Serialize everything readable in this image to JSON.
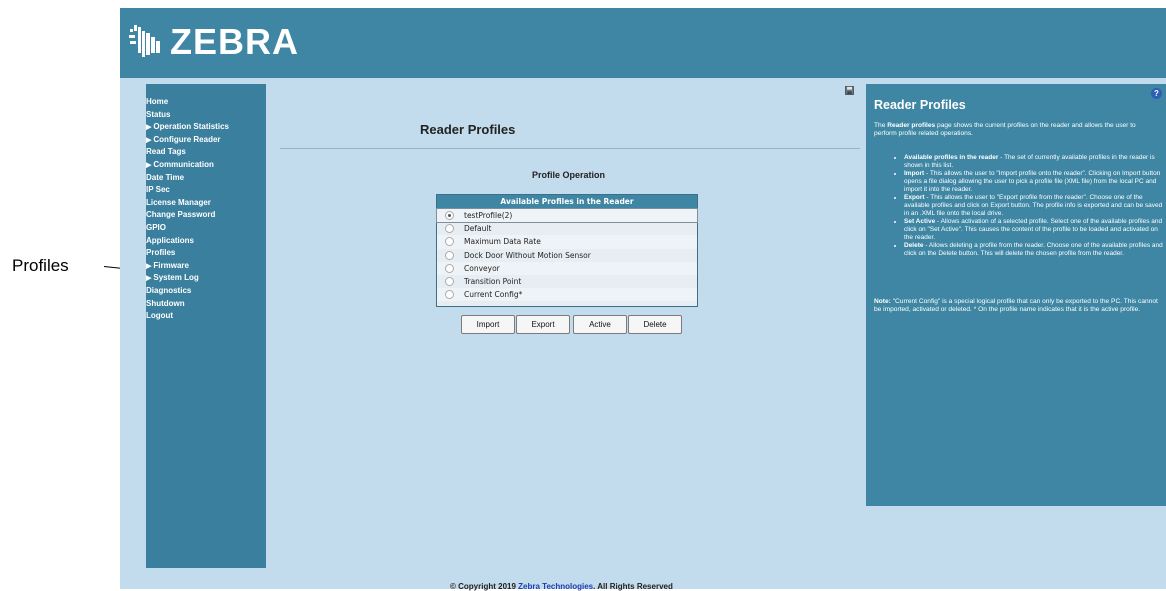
{
  "callout": {
    "label": "Profiles"
  },
  "brand": {
    "logo_text": "ZEBRA"
  },
  "sidebar": {
    "items": [
      {
        "label": "Home",
        "has_arrow": false
      },
      {
        "label": "Status",
        "has_arrow": false
      },
      {
        "label": "Operation Statistics",
        "has_arrow": true
      },
      {
        "label": "Configure Reader",
        "has_arrow": true
      },
      {
        "label": "Read Tags",
        "has_arrow": false
      },
      {
        "label": "Communication",
        "has_arrow": true
      },
      {
        "label": "Date Time",
        "has_arrow": false
      },
      {
        "label": "IP Sec",
        "has_arrow": false
      },
      {
        "label": "License Manager",
        "has_arrow": false
      },
      {
        "label": "Change Password",
        "has_arrow": false
      },
      {
        "label": "GPIO",
        "has_arrow": false
      },
      {
        "label": "Applications",
        "has_arrow": false
      },
      {
        "label": "Profiles",
        "has_arrow": false
      },
      {
        "label": "Firmware",
        "has_arrow": true
      },
      {
        "label": "System Log",
        "has_arrow": true
      },
      {
        "label": "Diagnostics",
        "has_arrow": false
      },
      {
        "label": "Shutdown",
        "has_arrow": false
      },
      {
        "label": "Logout",
        "has_arrow": false
      }
    ]
  },
  "main": {
    "title": "Reader Profiles",
    "subtitle": "Profile Operation",
    "save_icon": "save-icon",
    "profiles_header": "Available Profiles in the Reader",
    "profiles": [
      {
        "name": "testProfile(2)",
        "selected": true
      },
      {
        "name": "Default",
        "selected": false
      },
      {
        "name": "Maximum Data Rate",
        "selected": false
      },
      {
        "name": "Dock Door Without Motion Sensor",
        "selected": false
      },
      {
        "name": "Conveyor",
        "selected": false
      },
      {
        "name": "Transition Point",
        "selected": false
      },
      {
        "name": "Current Config*",
        "selected": false
      }
    ],
    "buttons": {
      "import": "Import",
      "export": "Export",
      "active": "Active",
      "delete": "Delete"
    }
  },
  "help": {
    "icon": "?",
    "title": "Reader Profiles",
    "intro_bold": "Reader profiles",
    "intro_pre": "The ",
    "intro_post": " page shows the current profiles on the reader and allows the user to perform profile related operations.",
    "items": [
      {
        "term": "Available profiles in the reader",
        "text": " - The set of currently available profiles in the reader is shown in this list."
      },
      {
        "term": "Import",
        "text": " - This allows the user to \"Import profile onto the reader\". Clicking on Import button opens a file dialog allowing the user to pick a profile file (XML file) from the local PC and import it into the reader."
      },
      {
        "term": "Export",
        "text": " - This allows the user to \"Export profile from the reader\". Choose one of the available profiles and click on Export button. The profile info is exported and can be saved in an .XML file onto the local drive."
      },
      {
        "term": "Set Active",
        "text": " - Allows activation of a selected profile. Select one of the available profiles and click on \"Set Active\". This causes the content of the profile to be loaded and activated on the reader."
      },
      {
        "term": "Delete",
        "text": " - Allows deleting a profile from the reader. Choose one of the available profiles and click on the Delete button. This will delete the chosen profile from the reader."
      }
    ],
    "note_label": "Note:",
    "note_text": " \"Current Config\" is a special logical profile that can only be exported to the PC. This cannot be imported, activated or deleted. * On the profile name indicates that it is the active profile."
  },
  "footer": {
    "pre": "© Copyright 2019 ",
    "link": "Zebra Technologies",
    "post": ". All Rights Reserved"
  },
  "colors": {
    "banner": "#3e86a3",
    "sidebar": "#3a7f9e",
    "page_bg": "#c2dbed",
    "help_bg": "#3e86a3"
  }
}
